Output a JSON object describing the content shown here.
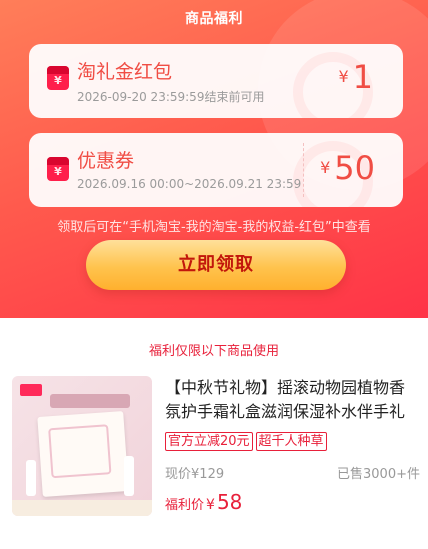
{
  "header": {
    "title": "商品福利"
  },
  "cards": [
    {
      "icon": "red-envelope-icon",
      "name": "淘礼金红包",
      "validity": "2026-09-20 23:59:59结束前可用",
      "currency": "¥",
      "amount": "1"
    },
    {
      "icon": "coupon-icon",
      "name": "优惠券",
      "validity": "2026.09.16 00:00~2026.09.21 23:59",
      "currency": "¥",
      "amount": "50"
    }
  ],
  "hint": "领取后可在“手机淘宝-我的淘宝-我的权益-红包”中查看",
  "claim_button": "立即领取",
  "section_label": "福利仅限以下商品使用",
  "product": {
    "title": "【中秋节礼物】摇滚动物园植物香氛护手霜礼盒滋润保湿补水伴手礼",
    "tags": [
      "官方立减20元",
      "超千人种草"
    ],
    "current_price_label": "现价",
    "current_price_currency": "¥",
    "current_price": "129",
    "sold": "已售3000+件",
    "welfare_price_label": "福利价",
    "welfare_price_currency": "¥",
    "welfare_price": "58"
  },
  "colors": {
    "banner_start": "#ff7e59",
    "banner_end": "#ff3347",
    "accent_red": "#e8203a",
    "amount_red": "#f04d44",
    "button_yellow": "#ffc34d"
  }
}
